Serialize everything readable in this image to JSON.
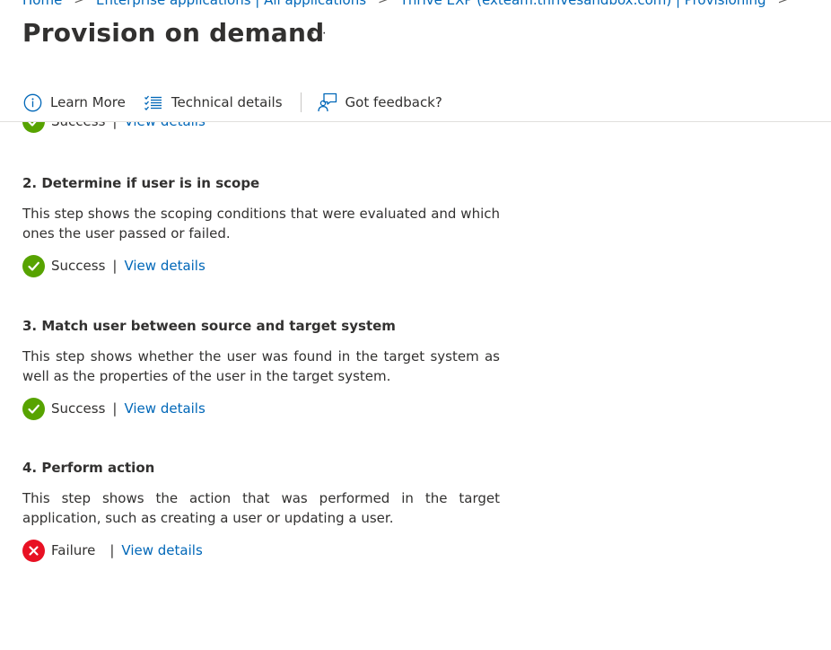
{
  "breadcrumb": {
    "items": [
      "Home",
      "Enterprise applications | All applications",
      "Thrive EXP (exteam.thrivesandbox.com) | Provisioning"
    ],
    "separator": ">"
  },
  "header": {
    "title": "Provision on demand",
    "more_label": "···"
  },
  "toolbar": {
    "learn_more": "Learn More",
    "technical_details": "Technical details",
    "feedback": "Got feedback?"
  },
  "step1": {
    "status": "Success",
    "separator": "|",
    "link": "View details"
  },
  "steps": [
    {
      "heading": "2. Determine if user is in scope",
      "description": "This step shows the scoping conditions that were evaluated and which ones the user passed or failed.",
      "status": "Success",
      "separator": "|",
      "link": "View details"
    },
    {
      "heading": "3. Match user between source and target system",
      "description": "This step shows whether the user was found in the target system as well as the properties of the user in the target system.",
      "status": "Success",
      "separator": "|",
      "link": "View details"
    },
    {
      "heading": "4. Perform action",
      "description": "This step shows the action that was performed in the target application, such as creating a user or updating a user.",
      "status": "Failure",
      "separator": "|",
      "link": "View details"
    }
  ],
  "colors": {
    "link": "#0067b8",
    "success": "#57a300",
    "failure": "#e81123",
    "text": "#323130"
  }
}
